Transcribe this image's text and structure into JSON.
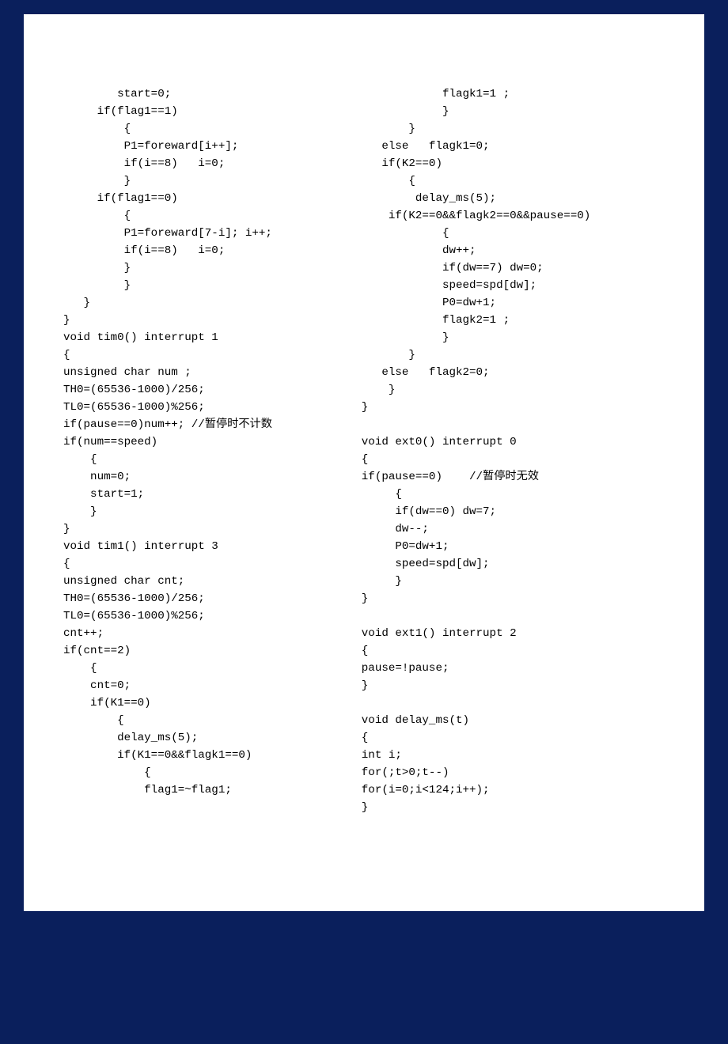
{
  "col1": "        start=0;\n     if(flag1==1)\n         {\n         P1=foreward[i++];\n         if(i==8)   i=0;\n         }\n     if(flag1==0)\n         {\n         P1=foreward[7-i]; i++;\n         if(i==8)   i=0;\n         }\n         }\n   }\n}\nvoid tim0() interrupt 1\n{\nunsigned char num ;\nTH0=(65536-1000)/256;\nTL0=(65536-1000)%256;\nif(pause==0)num++; //暂停时不计数\nif(num==speed)\n    {\n    num=0;\n    start=1;\n    }\n}\nvoid tim1() interrupt 3\n{\nunsigned char cnt;\nTH0=(65536-1000)/256;\nTL0=(65536-1000)%256;\ncnt++;\nif(cnt==2)\n    {\n    cnt=0;\n    if(K1==0)\n        {\n        delay_ms(5);\n        if(K1==0&&flagk1==0)\n            {\n            flag1=~flag1;",
  "col2": "            flagk1=1 ;\n            }\n       }\n   else   flagk1=0;\n   if(K2==0)\n       {\n        delay_ms(5);\n    if(K2==0&&flagk2==0&&pause==0)\n            {\n            dw++;\n            if(dw==7) dw=0;\n            speed=spd[dw];\n            P0=dw+1;\n            flagk2=1 ;\n            }\n       }\n   else   flagk2=0;\n    }\n}\n\nvoid ext0() interrupt 0\n{\nif(pause==0)    //暂停时无效\n     {\n     if(dw==0) dw=7;\n     dw--;\n     P0=dw+1;\n     speed=spd[dw];\n     }\n}\n\nvoid ext1() interrupt 2\n{\npause=!pause;\n}\n\nvoid delay_ms(t)\n{\nint i;\nfor(;t>0;t--)\nfor(i=0;i<124;i++);\n}"
}
